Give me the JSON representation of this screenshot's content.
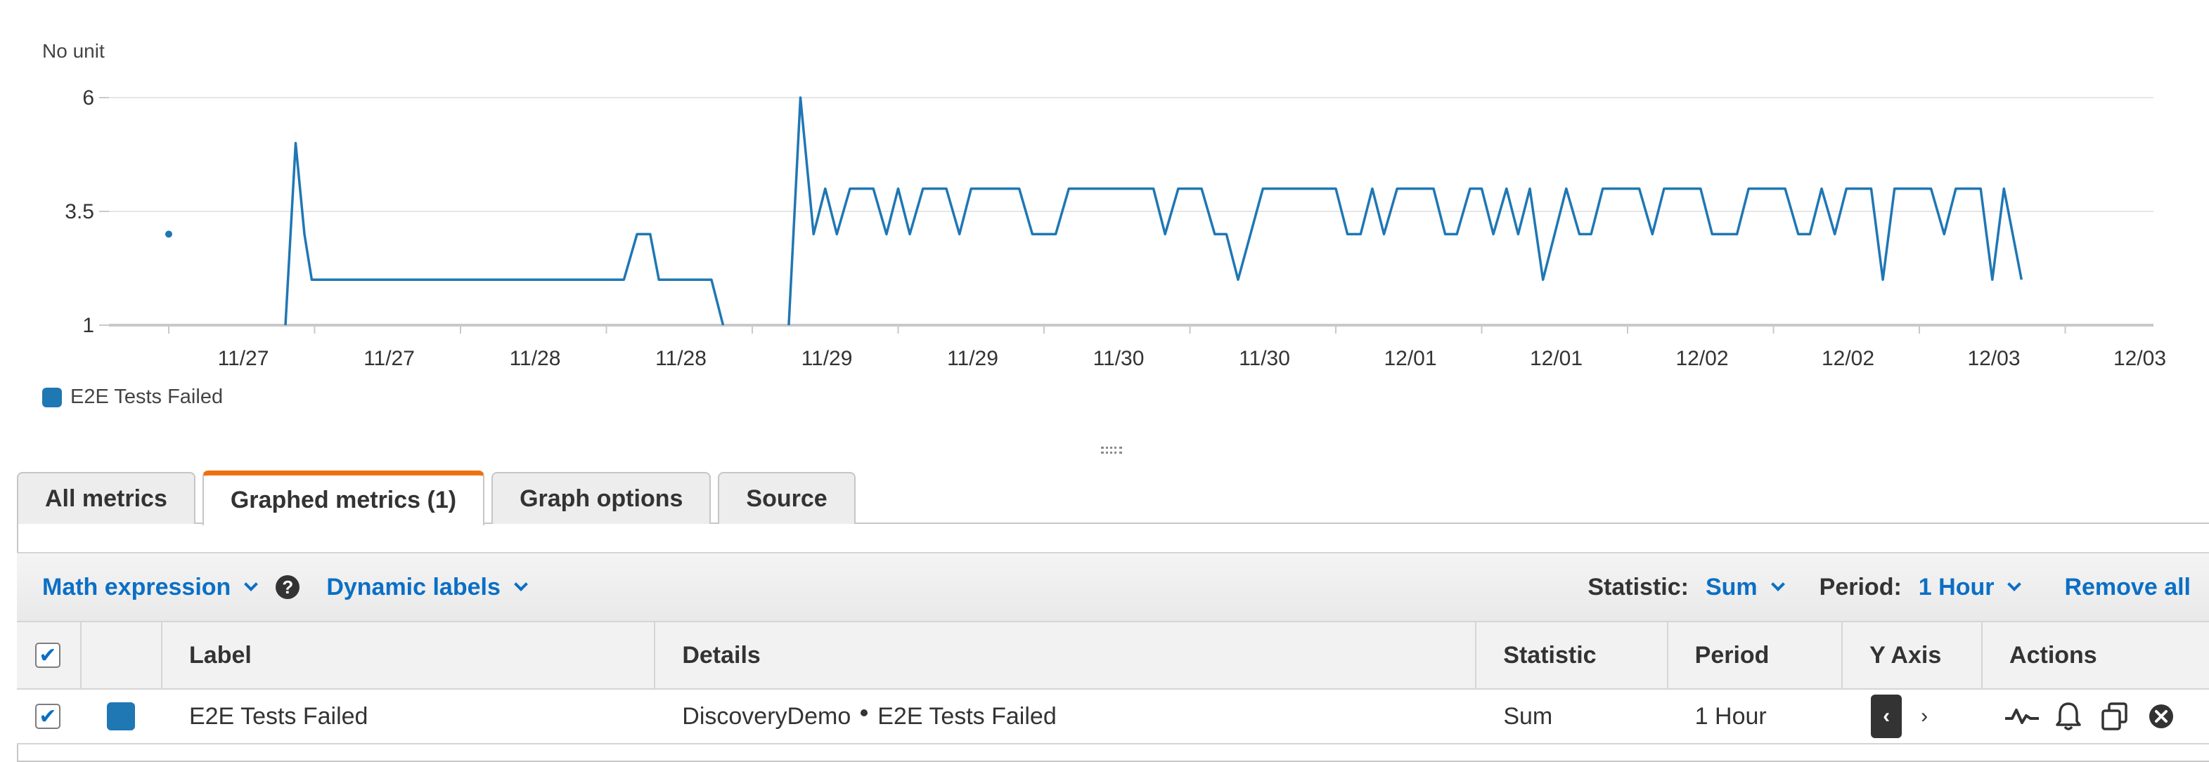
{
  "chart_data": {
    "type": "line",
    "ylabel": "No unit",
    "yticks": [
      "6",
      "3.5",
      "1"
    ],
    "ylim": [
      1,
      6
    ],
    "xticks": [
      "11/27",
      "11/27",
      "11/28",
      "11/28",
      "11/29",
      "11/29",
      "11/30",
      "11/30",
      "12/01",
      "12/01",
      "12/02",
      "12/02",
      "12/03",
      "12/03"
    ],
    "grid": true,
    "legend_position": "bottom-left",
    "series": [
      {
        "name": "E2E Tests Failed",
        "color": "#1f77b4",
        "isolated_points": [
          [
            0.0,
            3.0
          ]
        ],
        "segments": [
          [
            [
              0.8,
              1
            ],
            [
              0.87,
              5
            ],
            [
              0.93,
              3
            ],
            [
              0.98,
              2
            ],
            [
              3.12,
              2
            ],
            [
              3.21,
              3
            ],
            [
              3.3,
              3
            ],
            [
              3.36,
              2
            ],
            [
              3.72,
              2
            ],
            [
              3.8,
              1
            ]
          ],
          [
            [
              4.25,
              1
            ],
            [
              4.33,
              6
            ],
            [
              4.42,
              3
            ],
            [
              4.5,
              4
            ],
            [
              4.58,
              3
            ],
            [
              4.67,
              4
            ],
            [
              4.83,
              4
            ],
            [
              4.92,
              3
            ],
            [
              5.0,
              4
            ],
            [
              5.08,
              3
            ],
            [
              5.17,
              4
            ],
            [
              5.33,
              4
            ],
            [
              5.42,
              3
            ],
            [
              5.5,
              4
            ],
            [
              5.83,
              4
            ],
            [
              5.92,
              3
            ],
            [
              6.08,
              3
            ],
            [
              6.17,
              4
            ],
            [
              6.75,
              4
            ],
            [
              6.83,
              3
            ],
            [
              6.92,
              4
            ],
            [
              7.08,
              4
            ],
            [
              7.17,
              3
            ],
            [
              7.25,
              3
            ],
            [
              7.33,
              2
            ],
            [
              7.5,
              4
            ],
            [
              8.0,
              4
            ],
            [
              8.08,
              3
            ],
            [
              8.17,
              3
            ],
            [
              8.25,
              4
            ],
            [
              8.33,
              3
            ],
            [
              8.42,
              4
            ],
            [
              8.67,
              4
            ],
            [
              8.75,
              3
            ],
            [
              8.83,
              3
            ],
            [
              8.92,
              4
            ],
            [
              9.0,
              4
            ],
            [
              9.08,
              3
            ],
            [
              9.17,
              4
            ],
            [
              9.25,
              3
            ],
            [
              9.33,
              4
            ],
            [
              9.42,
              2
            ],
            [
              9.58,
              4
            ],
            [
              9.67,
              3
            ],
            [
              9.75,
              3
            ],
            [
              9.83,
              4
            ],
            [
              10.08,
              4
            ],
            [
              10.17,
              3
            ],
            [
              10.25,
              4
            ],
            [
              10.5,
              4
            ],
            [
              10.58,
              3
            ],
            [
              10.75,
              3
            ],
            [
              10.83,
              4
            ],
            [
              11.08,
              4
            ],
            [
              11.17,
              3
            ],
            [
              11.25,
              3
            ],
            [
              11.33,
              4
            ],
            [
              11.42,
              3
            ],
            [
              11.5,
              4
            ],
            [
              11.67,
              4
            ],
            [
              11.75,
              2
            ],
            [
              11.83,
              4
            ],
            [
              12.08,
              4
            ],
            [
              12.17,
              3
            ],
            [
              12.25,
              4
            ],
            [
              12.42,
              4
            ],
            [
              12.5,
              2
            ],
            [
              12.58,
              4
            ],
            [
              12.7,
              2
            ]
          ]
        ]
      }
    ]
  },
  "legend": {
    "label": "E2E Tests Failed",
    "color": "#1f77b4"
  },
  "tabs": [
    {
      "label": "All metrics"
    },
    {
      "label": "Graphed metrics (1)"
    },
    {
      "label": "Graph options"
    },
    {
      "label": "Source"
    }
  ],
  "toolbar": {
    "math_expression": "Math expression",
    "help_icon": "?",
    "dynamic_labels": "Dynamic labels",
    "statistic_label": "Statistic:",
    "statistic_value": "Sum",
    "period_label": "Period:",
    "period_value": "1 Hour",
    "remove_all": "Remove all"
  },
  "table": {
    "headers": {
      "label": "Label",
      "details": "Details",
      "statistic": "Statistic",
      "period": "Period",
      "y_axis": "Y Axis",
      "actions": "Actions"
    },
    "rows": [
      {
        "checked": true,
        "color": "#1f77b4",
        "label": "E2E Tests Failed",
        "details_namespace": "DiscoveryDemo",
        "details_metric": "E2E Tests Failed",
        "statistic": "Sum",
        "period": "1 Hour",
        "y_axis": "left",
        "actions": [
          "graph-icon",
          "alarm-bell-icon",
          "copy-icon",
          "remove-icon"
        ]
      }
    ]
  }
}
